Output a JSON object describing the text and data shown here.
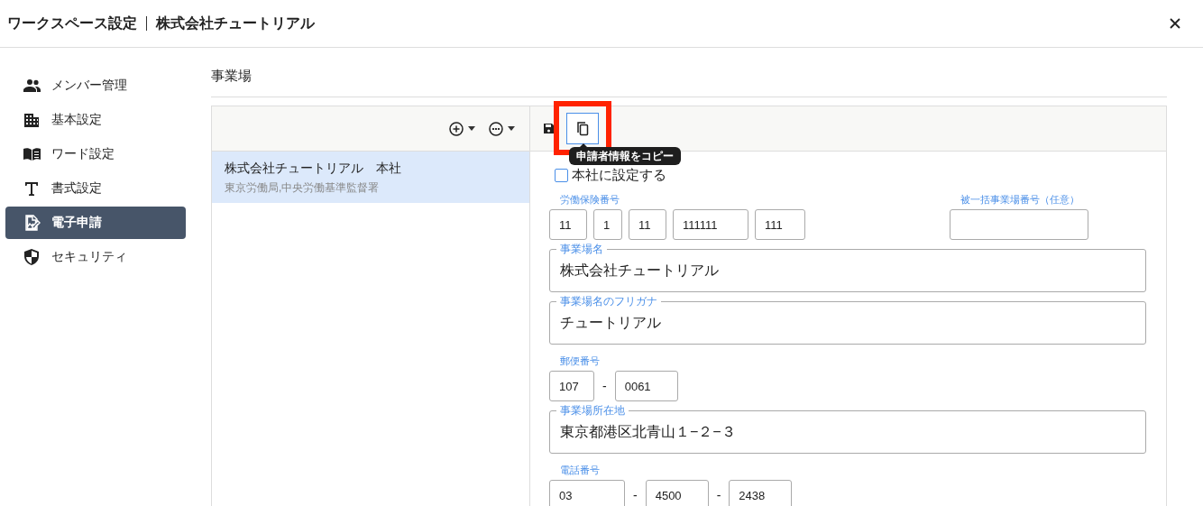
{
  "window": {
    "title": "ワークスペース設定",
    "subtitle": "株式会社チュートリアル"
  },
  "sidebar": {
    "items": [
      {
        "label": "メンバー管理",
        "selected": false
      },
      {
        "label": "基本設定",
        "selected": false
      },
      {
        "label": "ワード設定",
        "selected": false
      },
      {
        "label": "書式設定",
        "selected": false
      },
      {
        "label": "電子申請",
        "selected": true
      },
      {
        "label": "セキュリティ",
        "selected": false
      }
    ]
  },
  "section_title": "事業場",
  "workplaces": [
    {
      "name": "株式会社チュートリアル　本社",
      "detail": "東京労働局,中央労働基準監督署",
      "selected": true
    }
  ],
  "tooltip": "申請者情報をコピー",
  "head_office": {
    "label": "本社に設定する",
    "checked": false
  },
  "insurance_number": {
    "label": "労働保険番号",
    "parts": [
      "11",
      "1",
      "11",
      "111111",
      "111"
    ]
  },
  "bulk_number": {
    "label": "被一括事業場番号（任意）"
  },
  "fields": [
    {
      "kind": "outlined",
      "label": "事業場名",
      "value": "株式会社チュートリアル"
    },
    {
      "kind": "outlined",
      "label": "事業場名のフリガナ",
      "value": "チュートリアル"
    },
    {
      "kind": "split",
      "label": "郵便番号",
      "parts": [
        "107",
        "0061"
      ],
      "separators": [
        "-"
      ]
    },
    {
      "kind": "outlined",
      "label": "事業場所在地",
      "value": "東京都港区北青山１−２−３"
    },
    {
      "kind": "split",
      "label": "電話番号",
      "parts": [
        "03",
        "4500",
        "2438"
      ],
      "separators": [
        "-",
        "-"
      ]
    }
  ]
}
